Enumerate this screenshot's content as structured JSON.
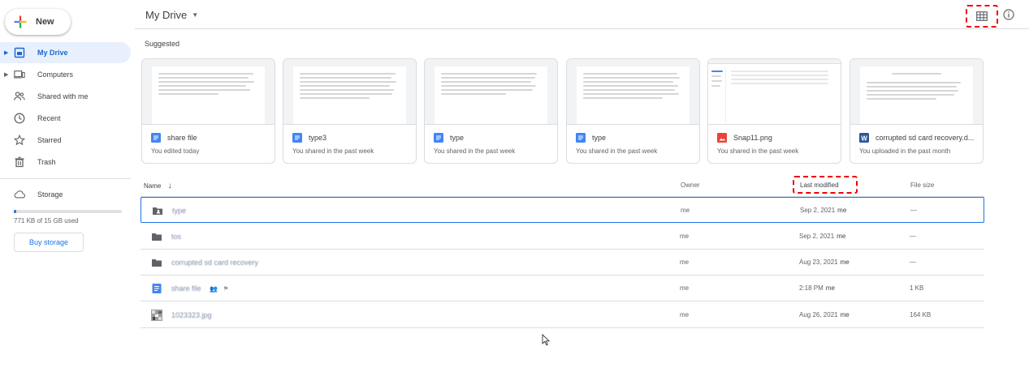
{
  "app": {
    "new_label": "New",
    "header_title": "My Drive"
  },
  "sidebar": {
    "items": [
      {
        "label": "My Drive",
        "icon": "my-drive-icon",
        "active": true
      },
      {
        "label": "Computers",
        "icon": "computer-icon"
      },
      {
        "label": "Shared with me",
        "icon": "people-icon"
      },
      {
        "label": "Recent",
        "icon": "clock-icon"
      },
      {
        "label": "Starred",
        "icon": "star-icon"
      },
      {
        "label": "Trash",
        "icon": "trash-icon"
      },
      {
        "label": "Storage",
        "icon": "cloud-icon"
      }
    ],
    "storage_used_text": "771 KB of 15 GB used",
    "storage_used_fraction": 0.02,
    "buy_storage_label": "Buy storage"
  },
  "suggested": {
    "label": "Suggested",
    "cards": [
      {
        "name": "share file",
        "sub": "You edited today",
        "type": "doc"
      },
      {
        "name": "type3",
        "sub": "You shared in the past week",
        "type": "doc"
      },
      {
        "name": "type",
        "sub": "You shared in the past week",
        "type": "doc"
      },
      {
        "name": "type",
        "sub": "You shared in the past week",
        "type": "doc"
      },
      {
        "name": "Snap11.png",
        "sub": "You shared in the past week",
        "type": "image"
      },
      {
        "name": "corrupted sd card recovery.d...",
        "sub": "You uploaded in the past month",
        "type": "word"
      }
    ]
  },
  "table": {
    "headers": {
      "name": "Name",
      "owner": "Owner",
      "last_modified": "Last modified",
      "file_size": "File size"
    },
    "rows": [
      {
        "name": "type",
        "type": "shared-folder",
        "owner": "me",
        "date": "Sep 2, 2021",
        "by": "me",
        "size": "—",
        "selected": true
      },
      {
        "name": "tos",
        "type": "folder",
        "owner": "me",
        "date": "Sep 2, 2021",
        "by": "me",
        "size": "—"
      },
      {
        "name": "corrupted sd card recovery",
        "type": "folder",
        "owner": "me",
        "date": "Aug 23, 2021",
        "by": "me",
        "size": "—"
      },
      {
        "name": "share file",
        "type": "doc",
        "owner": "me",
        "date": "2:18 PM",
        "by": "me",
        "size": "1 KB"
      },
      {
        "name": "1023323.jpg",
        "type": "image",
        "owner": "me",
        "date": "Aug 26, 2021",
        "by": "me",
        "size": "164 KB"
      }
    ]
  },
  "colors": {
    "accent": "#1a73e8",
    "active_bg": "#e8f0fe",
    "highlight_dash": "#ee0000"
  }
}
